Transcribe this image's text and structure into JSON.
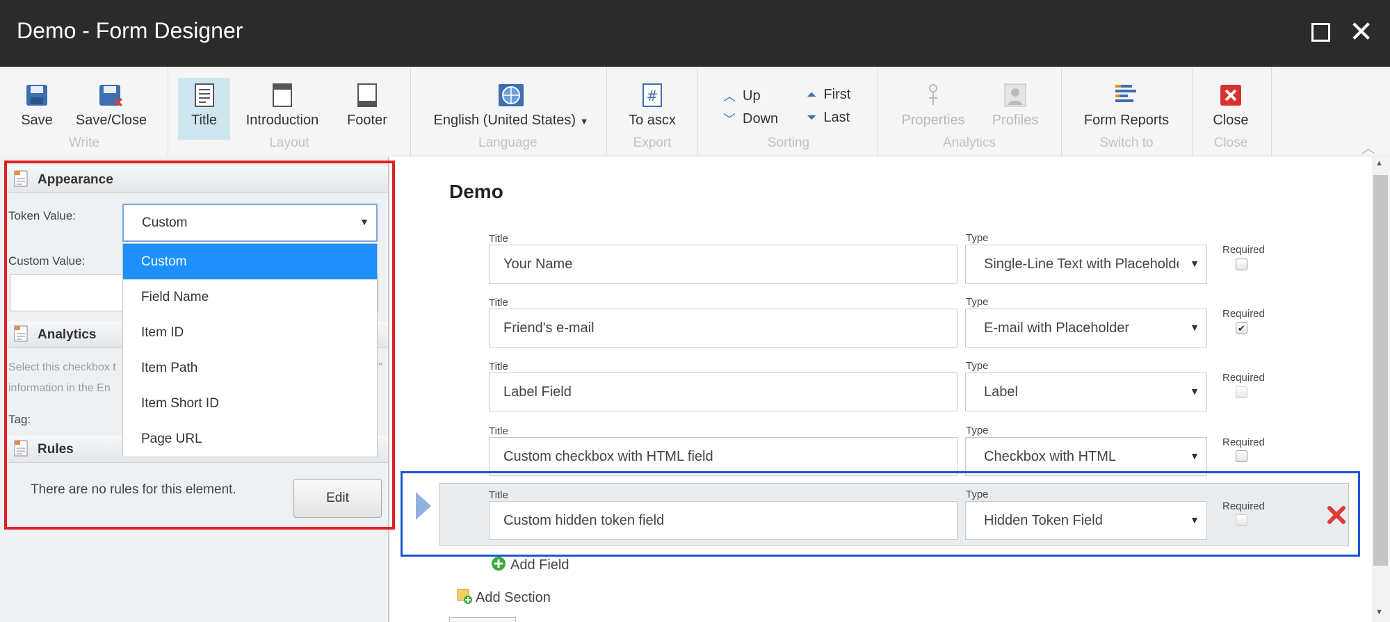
{
  "window": {
    "title": "Demo - Form Designer"
  },
  "ribbon": {
    "save": "Save",
    "save_close": "Save/Close",
    "group_write": "Write",
    "title": "Title",
    "introduction": "Introduction",
    "footer": "Footer",
    "group_layout": "Layout",
    "language": "English (United States)",
    "group_language": "Language",
    "to_ascx": "To ascx",
    "group_export": "Export",
    "up": "Up",
    "down": "Down",
    "first": "First",
    "last": "Last",
    "group_sorting": "Sorting",
    "properties": "Properties",
    "profiles": "Profiles",
    "group_analytics": "Analytics",
    "form_reports": "Form Reports",
    "group_switch": "Switch to",
    "close": "Close",
    "group_close": "Close"
  },
  "left": {
    "appearance": "Appearance",
    "token_label": "Token Value:",
    "token_value": "Custom",
    "custom_label": "Custom Value:",
    "analytics": "Analytics",
    "analytics_hint1": "Select this checkbox t",
    "analytics_hint2": "information in the En",
    "analytics_quote": "\"",
    "tag_label": "Tag:",
    "rules": "Rules",
    "no_rules": "There are no rules for this element.",
    "edit": "Edit",
    "dropdown_options": [
      "Custom",
      "Field Name",
      "Item ID",
      "Item Path",
      "Item Short ID",
      "Page URL"
    ]
  },
  "form": {
    "title": "Demo",
    "title_label": "Title",
    "type_label": "Type",
    "required_label": "Required",
    "fields": [
      {
        "title": "Your Name",
        "type": "Single-Line Text with Placeholder",
        "required": false,
        "disabled": false
      },
      {
        "title": "Friend's e-mail",
        "type": "E-mail with Placeholder",
        "required": true,
        "disabled": false
      },
      {
        "title": "Label Field",
        "type": "Label",
        "required": false,
        "disabled": true
      },
      {
        "title": "Custom checkbox with HTML field",
        "type": "Checkbox with HTML",
        "required": false,
        "disabled": false
      },
      {
        "title": "Custom hidden token field",
        "type": "Hidden Token Field",
        "required": false,
        "disabled": true
      }
    ],
    "add_field": "Add Field",
    "add_section": "Add Section"
  },
  "colors": {
    "highlight_red": "#e02020",
    "highlight_blue": "#1a56d6",
    "selected_option": "#1e90ff"
  }
}
